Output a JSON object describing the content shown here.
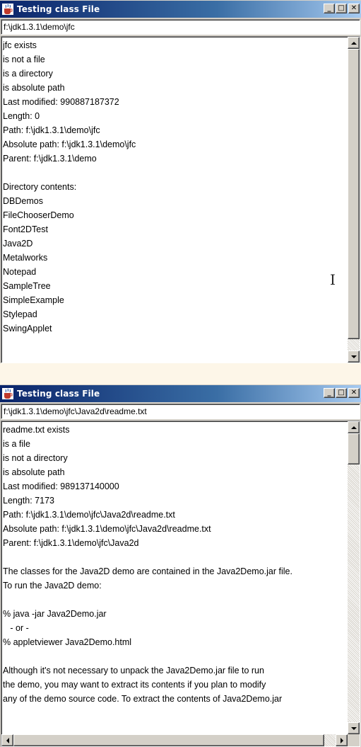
{
  "windows": [
    {
      "title": "Testing class File",
      "path": "f:\\jdk1.3.1\\demo\\jfc",
      "lines": [
        "jfc exists",
        "is not a file",
        "is a directory",
        "is absolute path",
        "Last modified: 990887187372",
        "Length: 0",
        "Path: f:\\jdk1.3.1\\demo\\jfc",
        "Absolute path: f:\\jdk1.3.1\\demo\\jfc",
        "Parent: f:\\jdk1.3.1\\demo",
        "",
        "Directory contents:",
        "DBDemos",
        "FileChooserDemo",
        "Font2DTest",
        "Java2D",
        "Metalworks",
        "Notepad",
        "SampleTree",
        "SimpleExample",
        "Stylepad",
        "SwingApplet"
      ]
    },
    {
      "title": "Testing class File",
      "path": "f:\\jdk1.3.1\\demo\\jfc\\Java2d\\readme.txt",
      "lines": [
        "readme.txt exists",
        "is a file",
        "is not a directory",
        "is absolute path",
        "Last modified: 989137140000",
        "Length: 7173",
        "Path: f:\\jdk1.3.1\\demo\\jfc\\Java2d\\readme.txt",
        "Absolute path: f:\\jdk1.3.1\\demo\\jfc\\Java2d\\readme.txt",
        "Parent: f:\\jdk1.3.1\\demo\\jfc\\Java2d",
        "",
        "The classes for the Java2D demo are contained in the Java2Demo.jar file.",
        "To run the Java2D demo:",
        "",
        "% java -jar Java2Demo.jar",
        "   - or -",
        "% appletviewer Java2Demo.html",
        "",
        "Although it's not necessary to unpack the Java2Demo.jar file to run",
        "the demo, you may want to extract its contents if you plan to modify",
        "any of the demo source code. To extract the contents of Java2Demo.jar"
      ]
    }
  ],
  "controls": {
    "minimize": "_",
    "maximize": "□",
    "close": "✕"
  },
  "colors": {
    "titlebar_start": "#0a246a",
    "titlebar_end": "#a6caf0",
    "face": "#d4d0c8",
    "desktop": "#fdf6e8"
  },
  "icons": {
    "app": "java-coffee-cup-icon",
    "cursor": "text-ibeam-cursor"
  }
}
